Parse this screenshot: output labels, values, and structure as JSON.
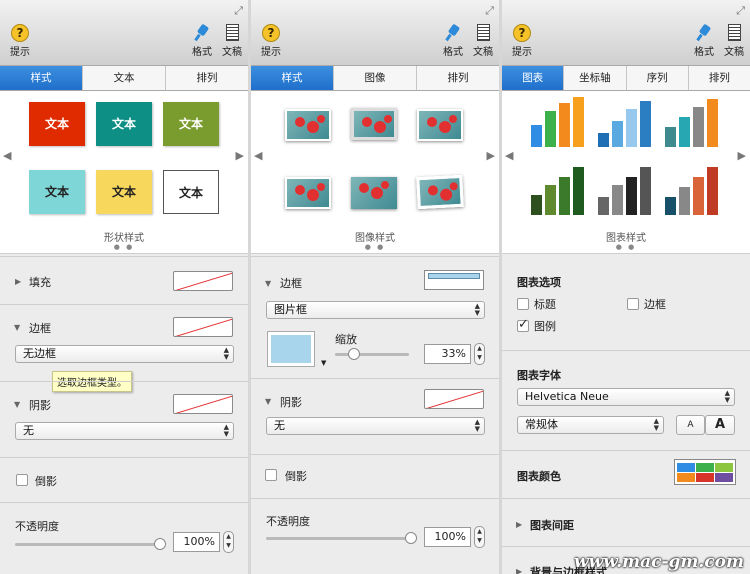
{
  "toolbar": {
    "tip_label": "提示",
    "format_label": "格式",
    "document_label": "文稿"
  },
  "panel1": {
    "tabs": [
      "样式",
      "文本",
      "排列"
    ],
    "swatches": [
      {
        "label": "文本",
        "bg": "#e02a00",
        "fg": "#ffffff"
      },
      {
        "label": "文本",
        "bg": "#0d8f86",
        "fg": "#ffffff"
      },
      {
        "label": "文本",
        "bg": "#7a9b2d",
        "fg": "#ffffff"
      },
      {
        "label": "文本",
        "bg": "#7fd6d6",
        "fg": "#222222"
      },
      {
        "label": "文本",
        "bg": "#f7d75c",
        "fg": "#222222"
      },
      {
        "label": "文本",
        "bg": "#ffffff",
        "fg": "#222222"
      }
    ],
    "gallery_caption": "形状样式",
    "fill_label": "填充",
    "border_label": "边框",
    "border_select": "无边框",
    "tooltip": "选取边框类型。",
    "shadow_label": "阴影",
    "shadow_select": "无",
    "reflection_label": "倒影",
    "opacity_label": "不透明度",
    "opacity_value": "100%",
    "opacity_level": 1.0
  },
  "panel2": {
    "tabs": [
      "样式",
      "图像",
      "排列"
    ],
    "gallery_caption": "图像样式",
    "border_label": "边框",
    "border_select": "图片框",
    "scale_label": "缩放",
    "scale_value": "33%",
    "scale_level": 0.25,
    "frame_color": "#a8d4ec",
    "shadow_label": "阴影",
    "shadow_select": "无",
    "reflection_label": "倒影",
    "opacity_label": "不透明度",
    "opacity_value": "100%",
    "opacity_level": 1.0
  },
  "panel3": {
    "tabs": [
      "图表",
      "坐标轴",
      "序列",
      "排列"
    ],
    "gallery_caption": "图表样式",
    "chart_options_title": "图表选项",
    "opt_title": "标题",
    "opt_border": "边框",
    "opt_legend": "图例",
    "opt_legend_checked": true,
    "font_title": "图表字体",
    "font_select": "Helvetica Neue",
    "style_select": "常规体",
    "font_smaller": "A",
    "font_larger": "A",
    "colors_title": "图表颜色",
    "chart_colors": [
      "#2f8de4",
      "#3cb04a",
      "#8cc63e",
      "#f28a1e",
      "#d8352a",
      "#6f4ea2"
    ],
    "spacing_title": "图表间距",
    "bg_border_title": "背景与边框样式",
    "chart_styles": [
      [
        "#2f8de4",
        "#3cb04a",
        "#f28a1e",
        "#f6a01d"
      ],
      [
        "#1e6fb5",
        "#5aa9e0",
        "#97c9ee",
        "#2b7ec2"
      ],
      [
        "#3e8a8e",
        "#27a7b2",
        "#888888",
        "#f28a1e"
      ],
      [
        "#2e4f1e",
        "#5f8a2e",
        "#3a7a2a",
        "#1f5a1e"
      ],
      [
        "#666666",
        "#888888",
        "#222222",
        "#555555"
      ],
      [
        "#18506a",
        "#888888",
        "#d9643a",
        "#c03b24"
      ]
    ]
  },
  "watermark": "www.mac-gm.com"
}
